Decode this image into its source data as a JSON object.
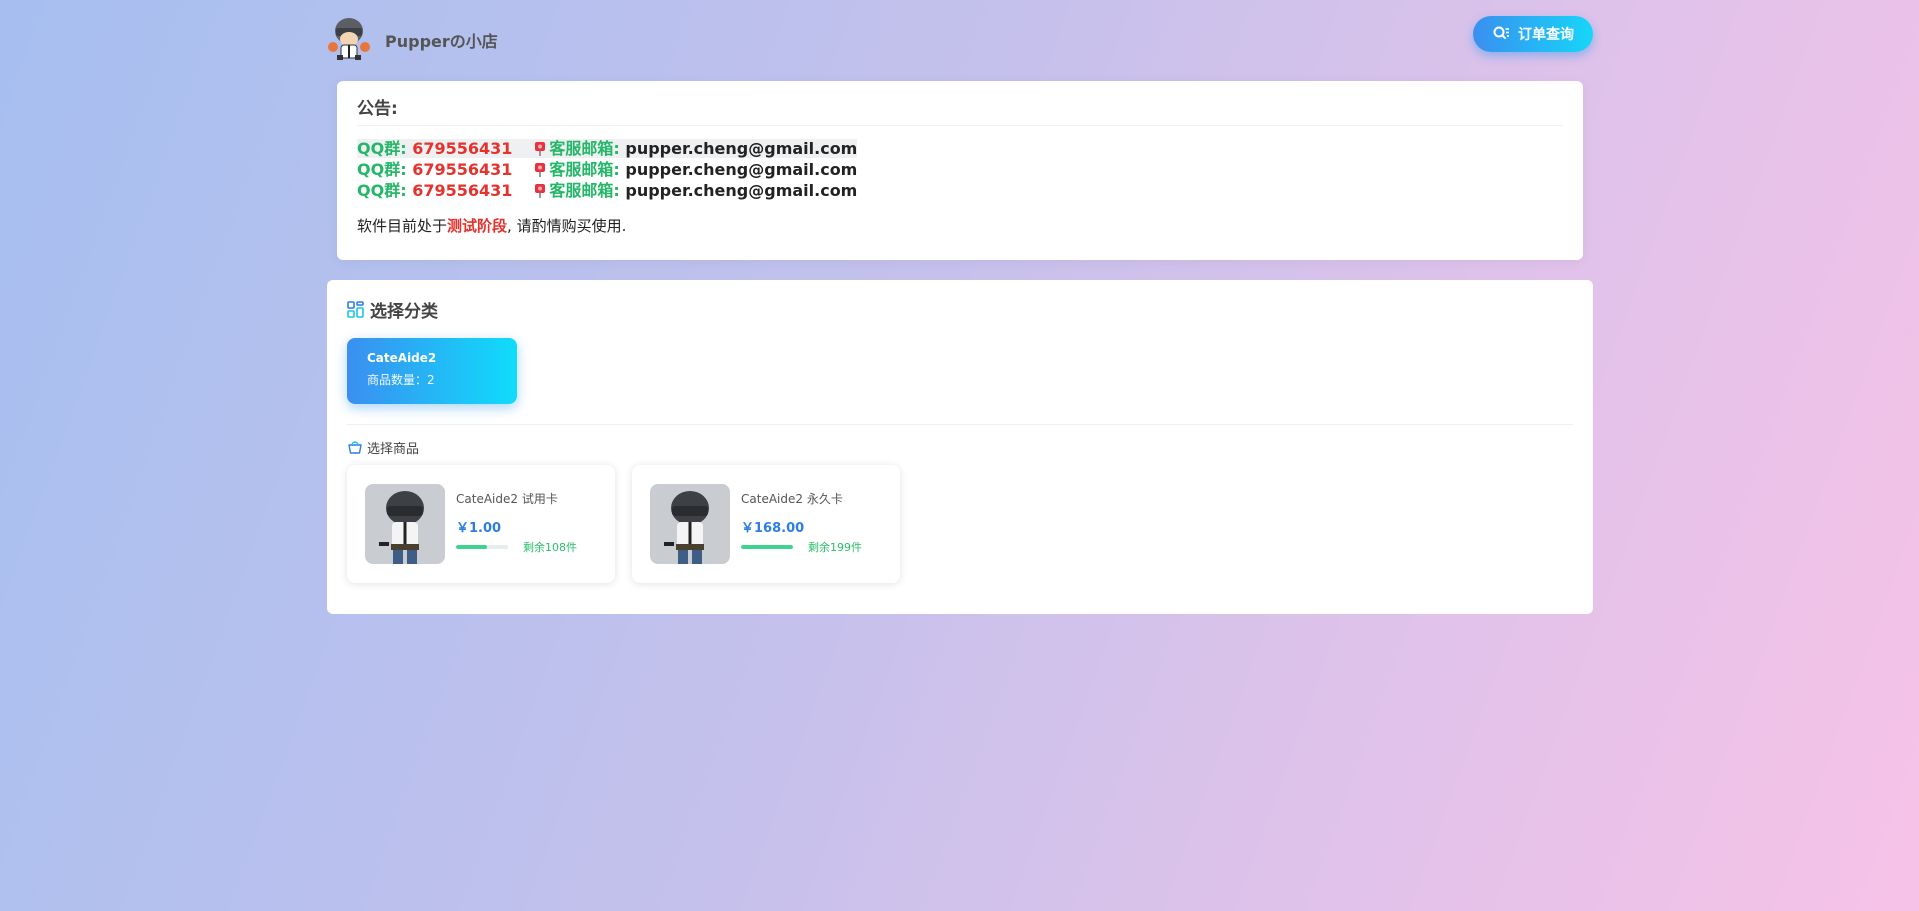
{
  "header": {
    "shop_name": "Pupperの小店",
    "order_query_label": "订单查询"
  },
  "notice": {
    "title": "公告:",
    "contacts": [
      {
        "qq_label": "QQ群:",
        "qq_number": "679556431",
        "mail_label": "客服邮箱:",
        "email": "pupper.cheng@gmail.com"
      },
      {
        "qq_label": "QQ群:",
        "qq_number": "679556431",
        "mail_label": "客服邮箱:",
        "email": "pupper.cheng@gmail.com"
      },
      {
        "qq_label": "QQ群:",
        "qq_number": "679556431",
        "mail_label": "客服邮箱:",
        "email": "pupper.cheng@gmail.com"
      }
    ],
    "beta_prefix": "软件目前处于",
    "beta_highlight": "测试阶段",
    "beta_suffix": ", 请酌情购买使用."
  },
  "category_section": {
    "title": "选择分类",
    "categories": [
      {
        "name": "CateAide2",
        "count_text": "商品数量：2"
      }
    ]
  },
  "goods_section": {
    "title": "选择商品",
    "items": [
      {
        "name": "CateAide2 试用卡",
        "price": "￥1.00",
        "stock_text": "剩余108件",
        "stock_fill": 0.6
      },
      {
        "name": "CateAide2 永久卡",
        "price": "￥168.00",
        "stock_text": "剩余199件",
        "stock_fill": 1.0
      }
    ]
  },
  "colors": {
    "accent_start": "#3a8ff0",
    "accent_end": "#10dcfb",
    "highlight_red": "#e5322d",
    "highlight_green": "#25b768",
    "price_blue": "#2c7ee6"
  },
  "icons": {
    "logo": "helmet-character-avatar",
    "order_query": "search-list-icon",
    "mail": "red-pin-icon",
    "category": "grid-icon",
    "goods": "shopping-bag-icon"
  }
}
